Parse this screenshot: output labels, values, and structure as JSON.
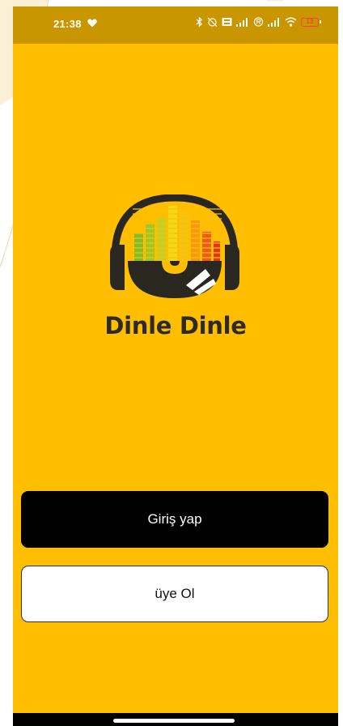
{
  "status_bar": {
    "time": "21:38",
    "battery_level": "13",
    "icons": [
      "heart-icon",
      "bluetooth-icon",
      "alarm-off-icon",
      "sim-icon",
      "signal-icon",
      "roaming-icon",
      "signal-icon-2",
      "wifi-icon",
      "battery-icon"
    ]
  },
  "brand": {
    "name": "Dinle Dinle"
  },
  "actions": {
    "login_label": "Giriş yap",
    "register_label": "üye Ol"
  },
  "colors": {
    "background": "#FFBE00",
    "status_bar": "#C99600",
    "login_button": "#000000",
    "register_button": "#FFFFFF",
    "brand_text": "#2E2A22"
  }
}
